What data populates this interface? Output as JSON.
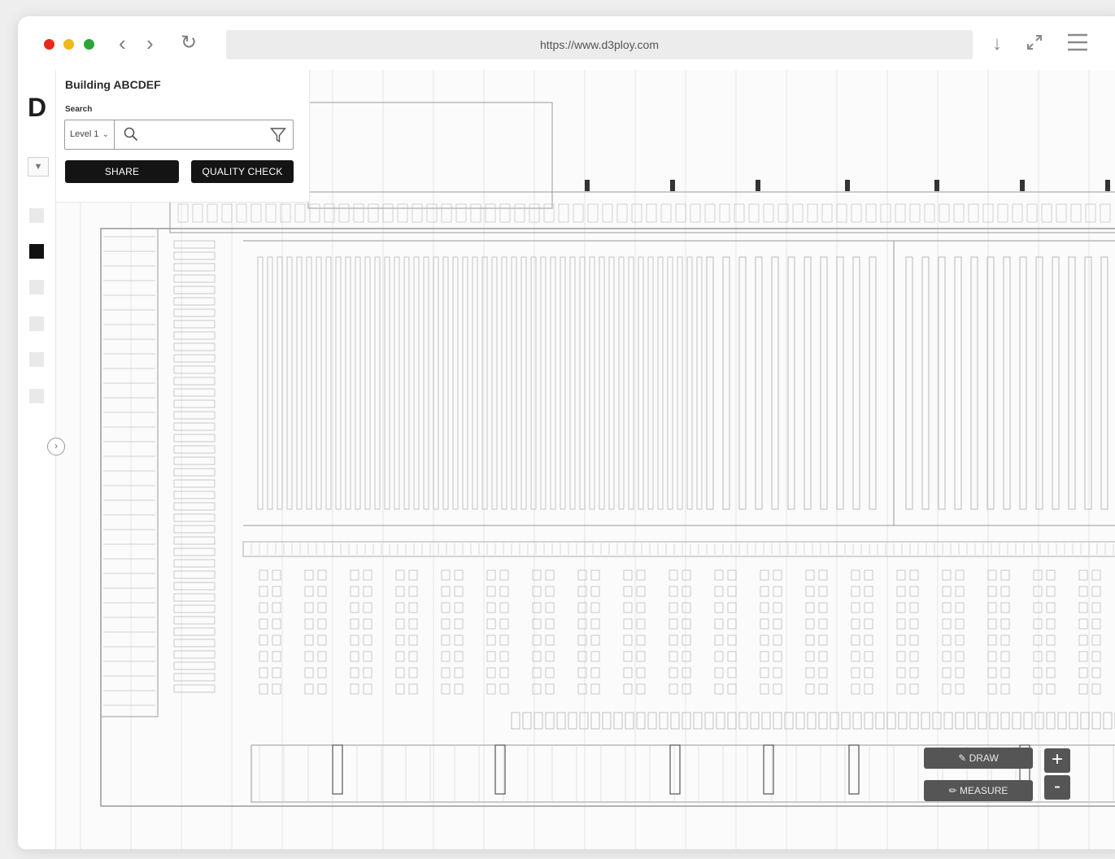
{
  "browser": {
    "url": "https://www.d3ploy.com",
    "traffic_light_colors": [
      "#e8281e",
      "#f1b81c",
      "#2aa638"
    ],
    "back_icon": "chevron-left-icon",
    "forward_icon": "chevron-right-icon",
    "reload_icon": "reload-icon",
    "download_icon": "download-arrow-icon",
    "expand_icon": "expand-icon",
    "menu_icon": "hamburger-menu-icon"
  },
  "app": {
    "logo": "D"
  },
  "panel": {
    "title": "Building ABCDEF",
    "search_label": "Search",
    "level_value": "Level 1",
    "share_label": "SHARE",
    "quality_check_label": "QUALITY CHECK"
  },
  "tools": {
    "draw_label": "DRAW",
    "measure_label": "MEASURE",
    "zoom_in_label": "+",
    "zoom_out_label": "-"
  },
  "colors": {
    "button_dark": "#141414",
    "tool_button": "#555555",
    "map_line": "#9a9a9a"
  }
}
